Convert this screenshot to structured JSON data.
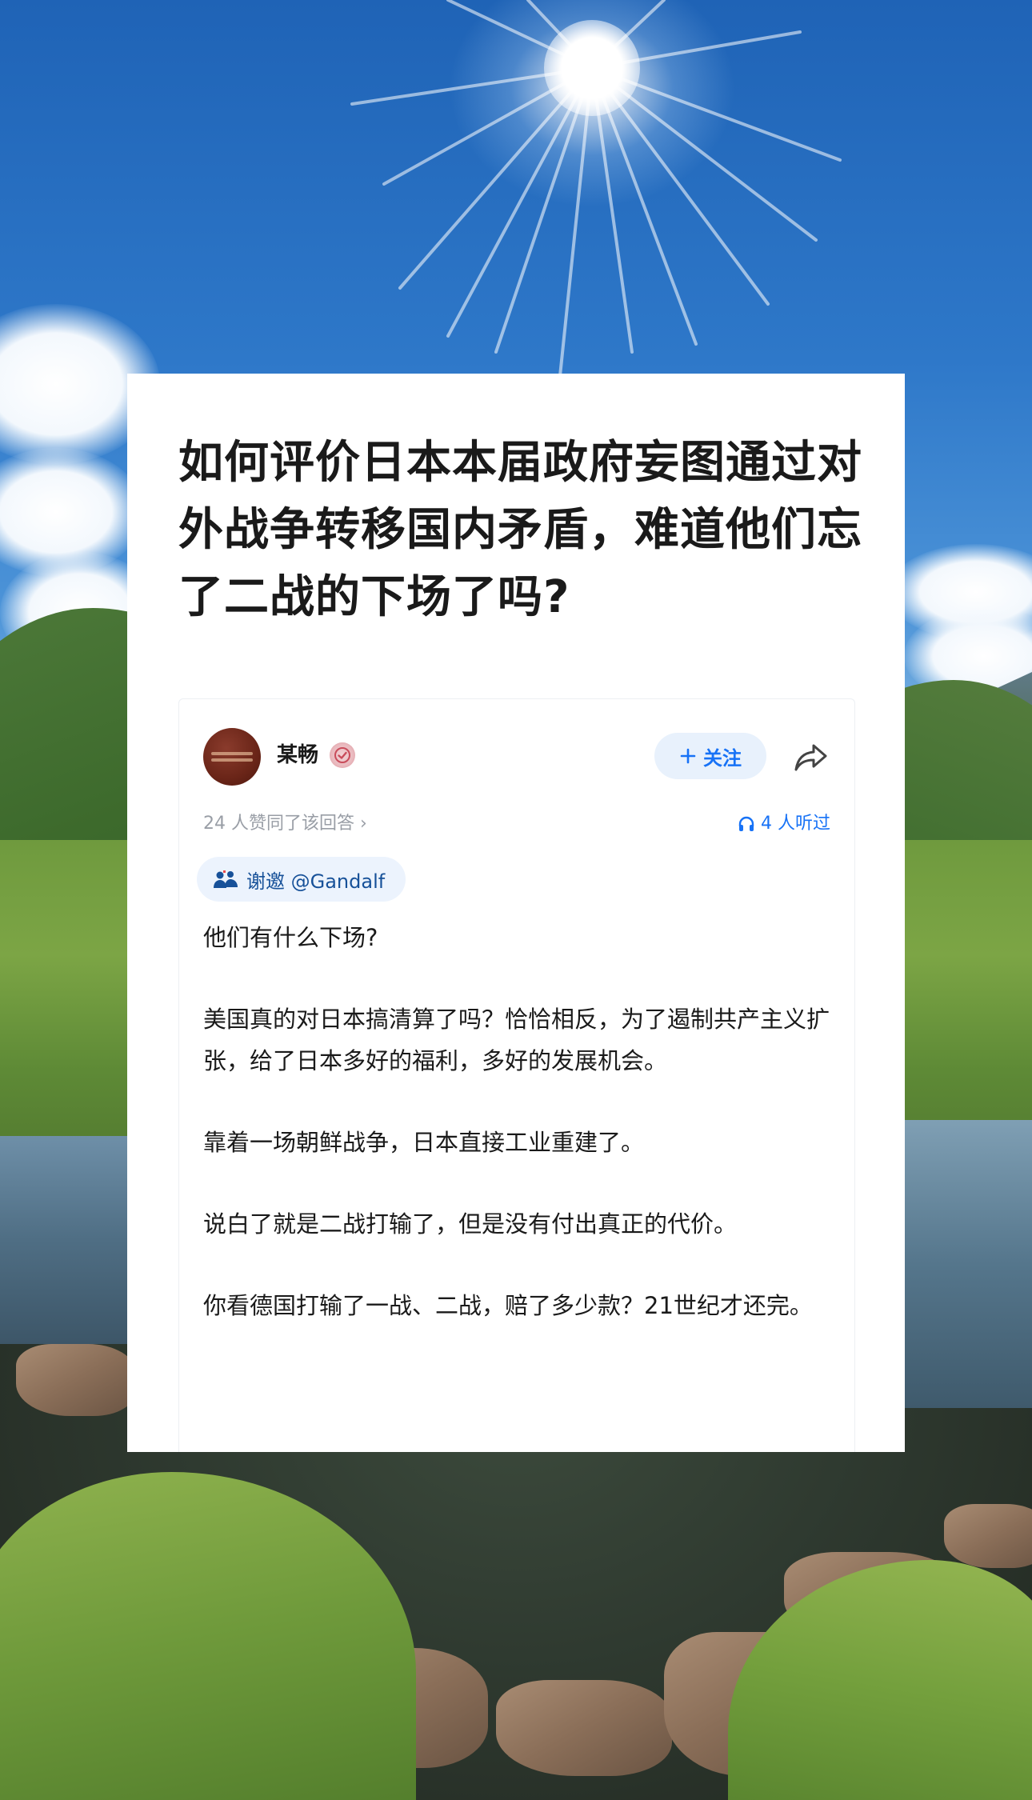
{
  "question": {
    "title": "如何评价日本本届政府妄图通过对外战争转移国内矛盾，难道他们忘了二战的下场了吗?"
  },
  "answer": {
    "author": {
      "name": "某畅",
      "avatar_icon": "avatar-image",
      "badge_icon": "verified-badge-icon"
    },
    "follow_label": "关注",
    "share_icon": "share-icon",
    "likes_text": "24 人赞同了该回答",
    "listeners_text": "4 人听过",
    "invite_text": "谢邀 @Gandalf",
    "paragraphs": [
      "他们有什么下场?",
      "美国真的对日本搞清算了吗？恰恰相反，为了遏制共产主义扩张，给了日本多好的福利，多好的发展机会。",
      "靠着一场朝鲜战争，日本直接工业重建了。",
      "说白了就是二战打输了，但是没有付出真正的代价。",
      "你看德国打输了一战、二战，赔了多少款？21世纪才还完。"
    ]
  },
  "colors": {
    "accent": "#1772f6",
    "follow_bg": "#e8f1fc",
    "invite_text": "#175199",
    "muted_text": "#999ea6"
  }
}
